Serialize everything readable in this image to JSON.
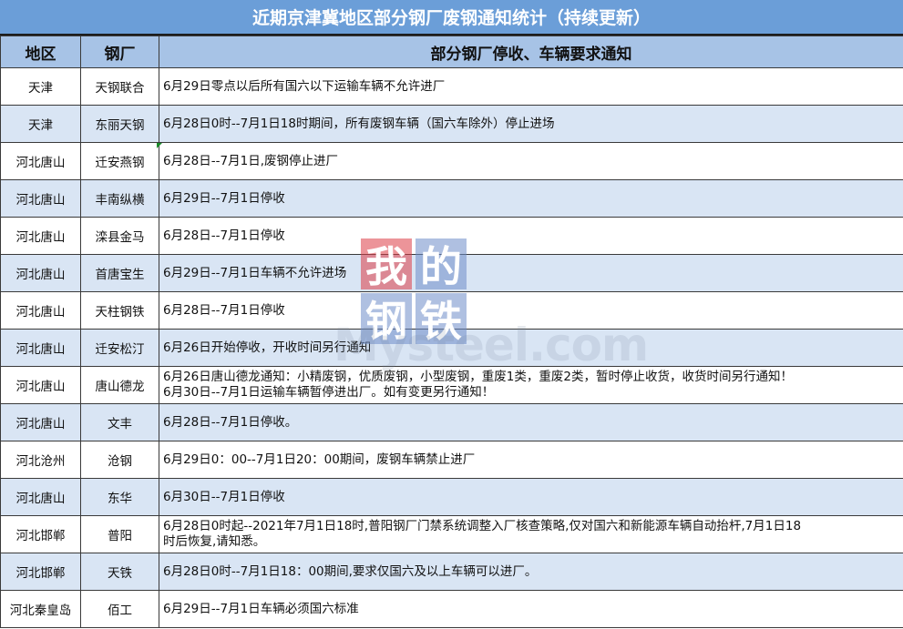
{
  "title": "近期京津冀地区部分钢厂废钢通知统计（持续更新）",
  "headers": {
    "region": "地区",
    "mill": "钢厂",
    "notice": "部分钢厂停收、车辆要求通知"
  },
  "rows": [
    {
      "region": "天津",
      "mill": "天钢联合",
      "notice": [
        "6月29日零点以后所有国六以下运输车辆不允许进厂"
      ]
    },
    {
      "region": "天津",
      "mill": "东丽天钢",
      "notice": [
        "6月28日0时--7月1日18时期间，所有废钢车辆（国六车除外）停止进场"
      ]
    },
    {
      "region": "河北唐山",
      "mill": "迁安燕钢",
      "notice": [
        "6月28日--7月1日,废钢停止进厂"
      ]
    },
    {
      "region": "河北唐山",
      "mill": "丰南纵横",
      "notice": [
        "6月29日--7月1日停收"
      ]
    },
    {
      "region": "河北唐山",
      "mill": "滦县金马",
      "notice": [
        "6月28日--7月1日停收"
      ]
    },
    {
      "region": "河北唐山",
      "mill": "首唐宝生",
      "notice": [
        "6月29日--7月1日车辆不允许进场"
      ]
    },
    {
      "region": "河北唐山",
      "mill": "天柱钢铁",
      "notice": [
        "6月28日--7月1日停收"
      ]
    },
    {
      "region": "河北唐山",
      "mill": "迁安松汀",
      "notice": [
        "6月26日开始停收，开收时间另行通知"
      ]
    },
    {
      "region": "河北唐山",
      "mill": "唐山德龙",
      "notice": [
        "6月26日唐山德龙通知：小精废钢，优质废钢，小型废钢，重废1类，重废2类，暂时停止收货，收货时间另行通知！",
        "6月30日--7月1日运输车辆暂停进出厂。如有变更另行通知！"
      ]
    },
    {
      "region": "河北唐山",
      "mill": "文丰",
      "notice": [
        "6月28日--7月1日停收。"
      ]
    },
    {
      "region": "河北沧州",
      "mill": "沧钢",
      "notice": [
        "6月29日0：00--7月1日20：00期间，废钢车辆禁止进厂"
      ]
    },
    {
      "region": "河北唐山",
      "mill": "东华",
      "notice": [
        "6月30日--7月1日停收"
      ]
    },
    {
      "region": "河北邯郸",
      "mill": "普阳",
      "notice": [
        "6月28日0时起--2021年7月1日18时,普阳钢厂门禁系统调整入厂核查策略,仅对国六和新能源车辆自动抬杆,7月1日18",
        "时后恢复,请知悉。"
      ]
    },
    {
      "region": "河北邯郸",
      "mill": "天铁",
      "notice": [
        "6月28日0时--7月1日18：00期间,要求仅国六及以上车辆可以进厂。"
      ]
    },
    {
      "region": "河北秦皇岛",
      "mill": "佰工",
      "notice": [
        "6月29日--7月1日车辆必须国六标准"
      ]
    }
  ],
  "watermark": {
    "chars": [
      "我",
      "的",
      "钢",
      "铁"
    ],
    "url": "Mysteel.com"
  },
  "colors": {
    "title_bg": "#6b9ed8",
    "header_bg": "#a7c3e6",
    "alt_row_bg": "#d9e5f4"
  }
}
